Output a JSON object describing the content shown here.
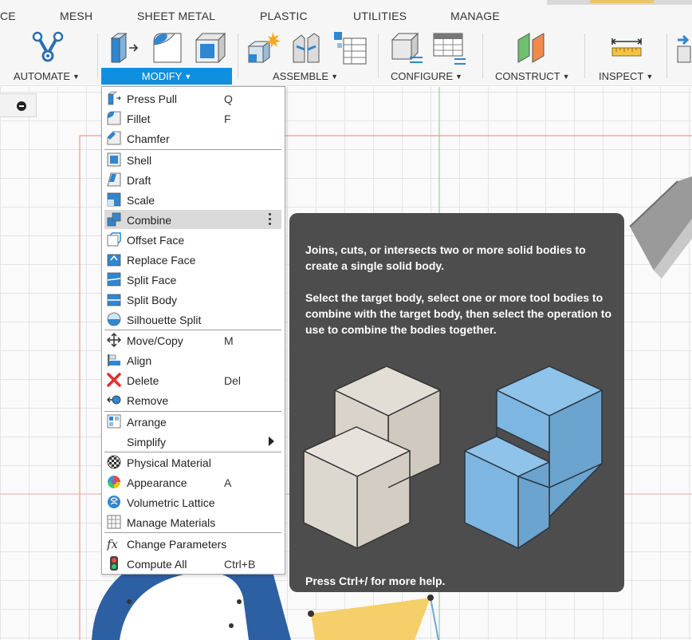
{
  "tabs": [
    "CE",
    "MESH",
    "SHEET METAL",
    "PLASTIC",
    "UTILITIES",
    "MANAGE"
  ],
  "toolbar": {
    "groups": [
      "AUTOMATE",
      "MODIFY",
      "ASSEMBLE",
      "CONFIGURE",
      "CONSTRUCT",
      "INSPECT"
    ]
  },
  "menu": {
    "items": [
      {
        "label": "Press Pull",
        "shortcut": "Q"
      },
      {
        "label": "Fillet",
        "shortcut": "F"
      },
      {
        "label": "Chamfer",
        "shortcut": ""
      },
      {
        "label": "Shell",
        "shortcut": ""
      },
      {
        "label": "Draft",
        "shortcut": ""
      },
      {
        "label": "Scale",
        "shortcut": ""
      },
      {
        "label": "Combine",
        "shortcut": ""
      },
      {
        "label": "Offset Face",
        "shortcut": ""
      },
      {
        "label": "Replace Face",
        "shortcut": ""
      },
      {
        "label": "Split Face",
        "shortcut": ""
      },
      {
        "label": "Split Body",
        "shortcut": ""
      },
      {
        "label": "Silhouette Split",
        "shortcut": ""
      },
      {
        "label": "Move/Copy",
        "shortcut": "M"
      },
      {
        "label": "Align",
        "shortcut": ""
      },
      {
        "label": "Delete",
        "shortcut": "Del"
      },
      {
        "label": "Remove",
        "shortcut": ""
      },
      {
        "label": "Arrange",
        "shortcut": ""
      },
      {
        "label": "Simplify",
        "shortcut": ""
      },
      {
        "label": "Physical Material",
        "shortcut": ""
      },
      {
        "label": "Appearance",
        "shortcut": "A"
      },
      {
        "label": "Volumetric Lattice",
        "shortcut": ""
      },
      {
        "label": "Manage Materials",
        "shortcut": ""
      },
      {
        "label": "Change Parameters",
        "shortcut": ""
      },
      {
        "label": "Compute All",
        "shortcut": "Ctrl+B"
      }
    ],
    "highlighted": "Combine"
  },
  "tooltip": {
    "description": "Joins, cuts, or intersects two or more solid bodies to create a single solid body.",
    "instructions": "Select the target body, select one or more tool bodies to combine with the target body, then select the operation to use to combine the bodies together.",
    "footer": "Press Ctrl+/ for more help."
  },
  "colors": {
    "accent": "#0f8fdf",
    "tooltip_bg": "#4d4d4d",
    "menu_highlight": "#dadada"
  }
}
